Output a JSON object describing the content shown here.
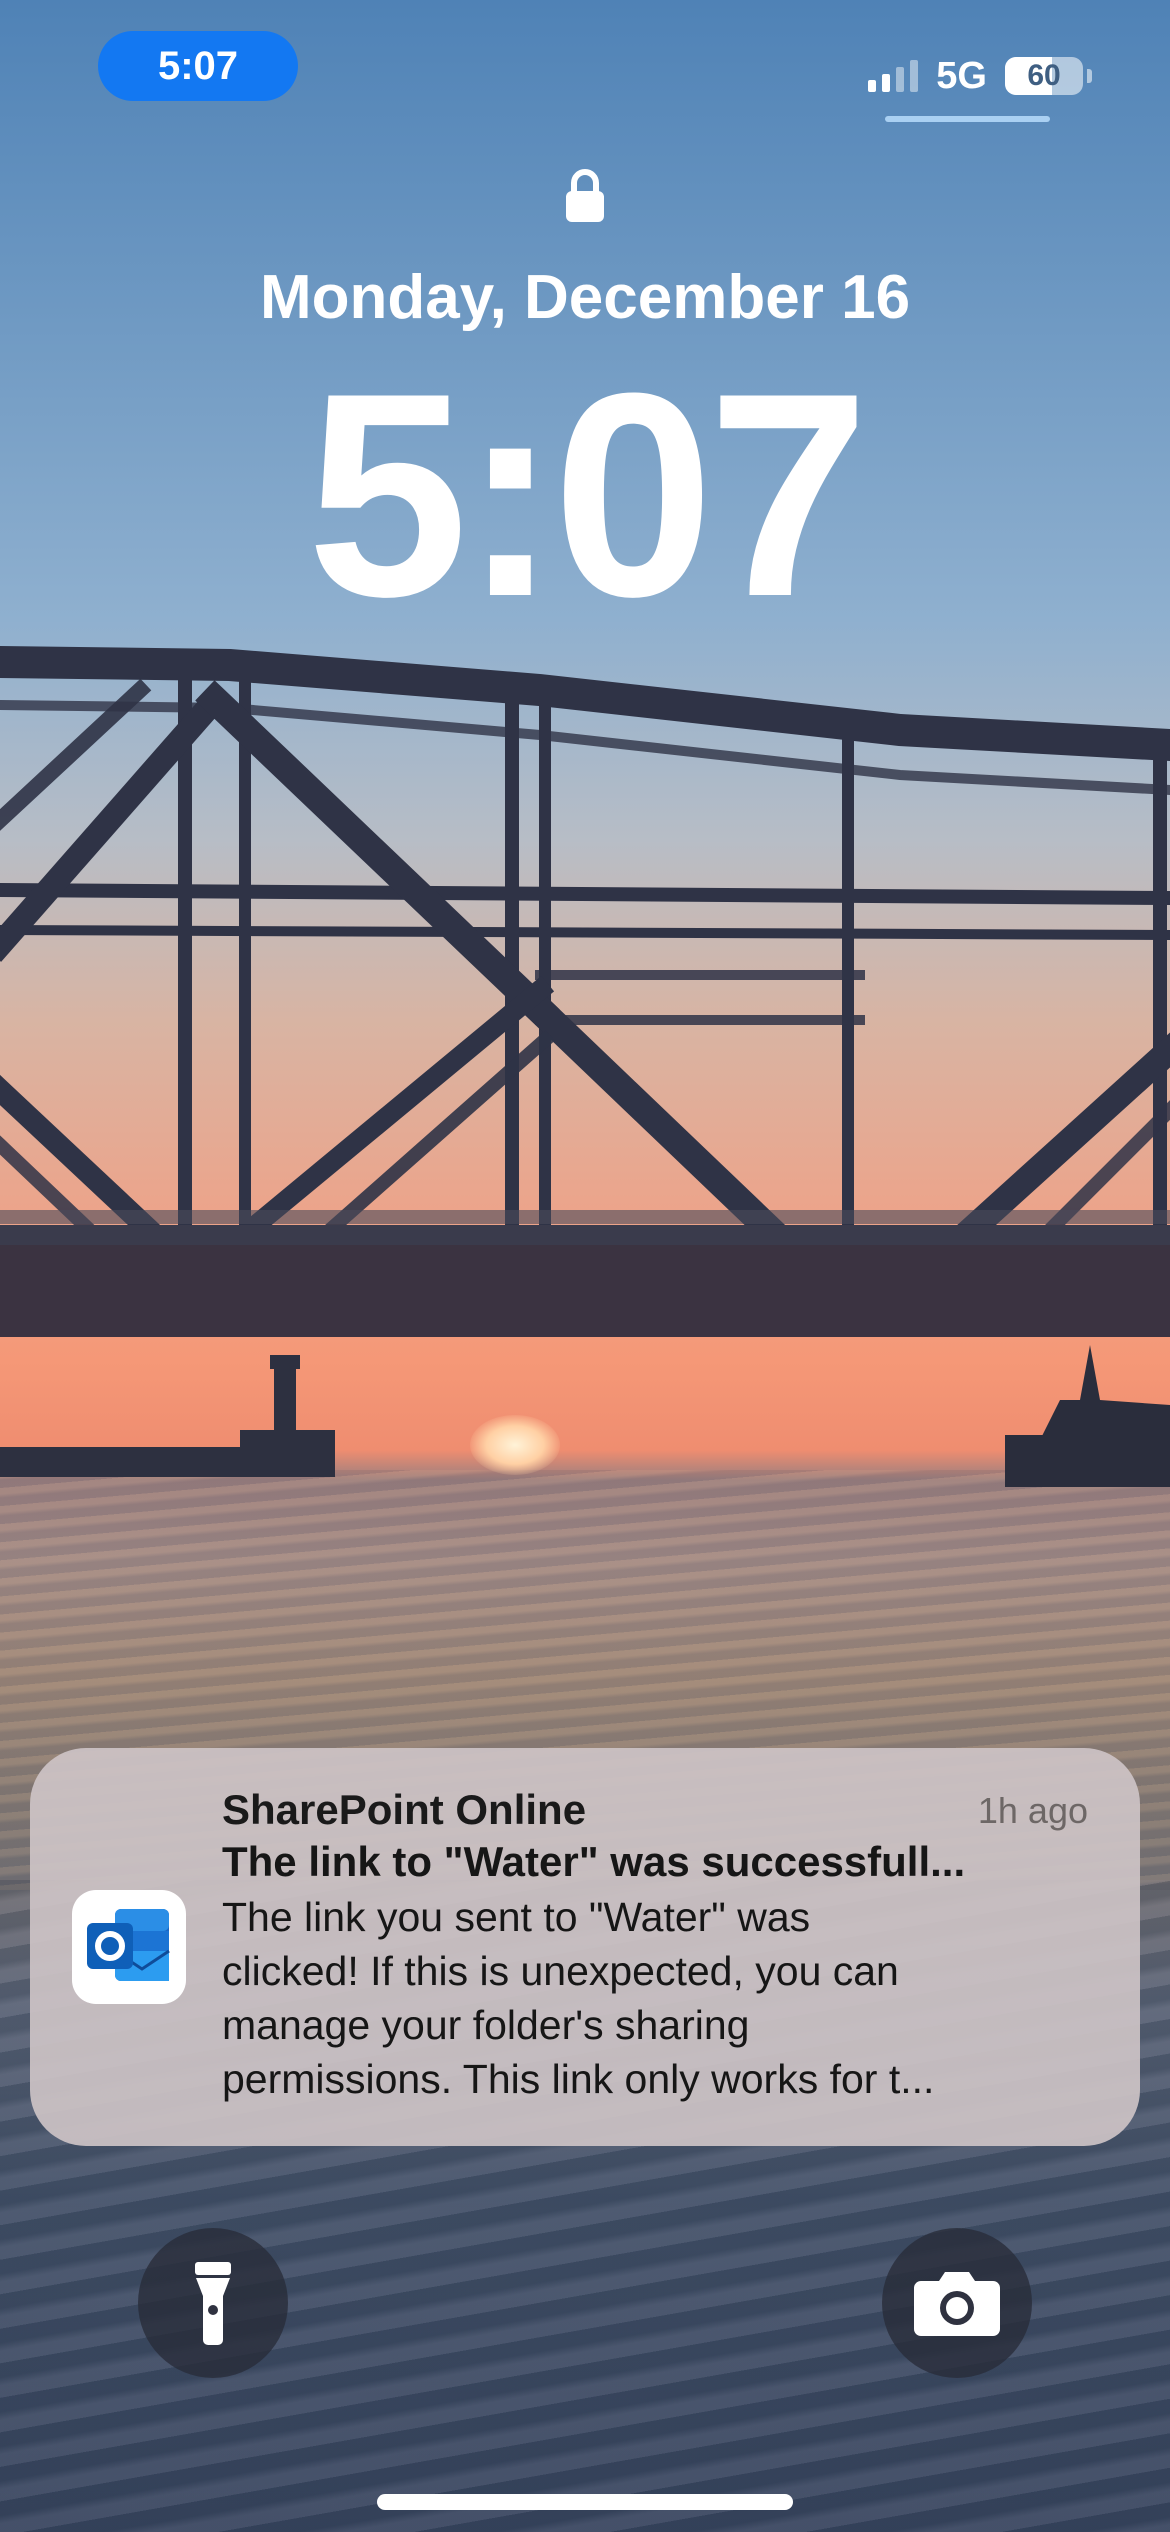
{
  "status_bar": {
    "time": "5:07",
    "network": "5G",
    "battery_percent": "60",
    "battery_level": 0.6,
    "signal_bars_active": 2,
    "signal_bars_total": 4
  },
  "lock_screen": {
    "date": "Monday, December 16",
    "time": "5:07"
  },
  "notification": {
    "app_name": "SharePoint Online",
    "timestamp": "1h ago",
    "title": "The link to \"Water\" was successfull...",
    "body_lines": [
      "The link you sent to \"Water\" was",
      "clicked! If this is unexpected, you can",
      "manage your folder's sharing",
      "permissions. This link only works for t..."
    ],
    "icon": "outlook-app-icon"
  },
  "controls": {
    "left": "flashlight-icon",
    "right": "camera-icon"
  },
  "colors": {
    "time_pill": "#1378f2",
    "notification_bg": "#cdc3c6",
    "button_bg": "#282c38"
  }
}
